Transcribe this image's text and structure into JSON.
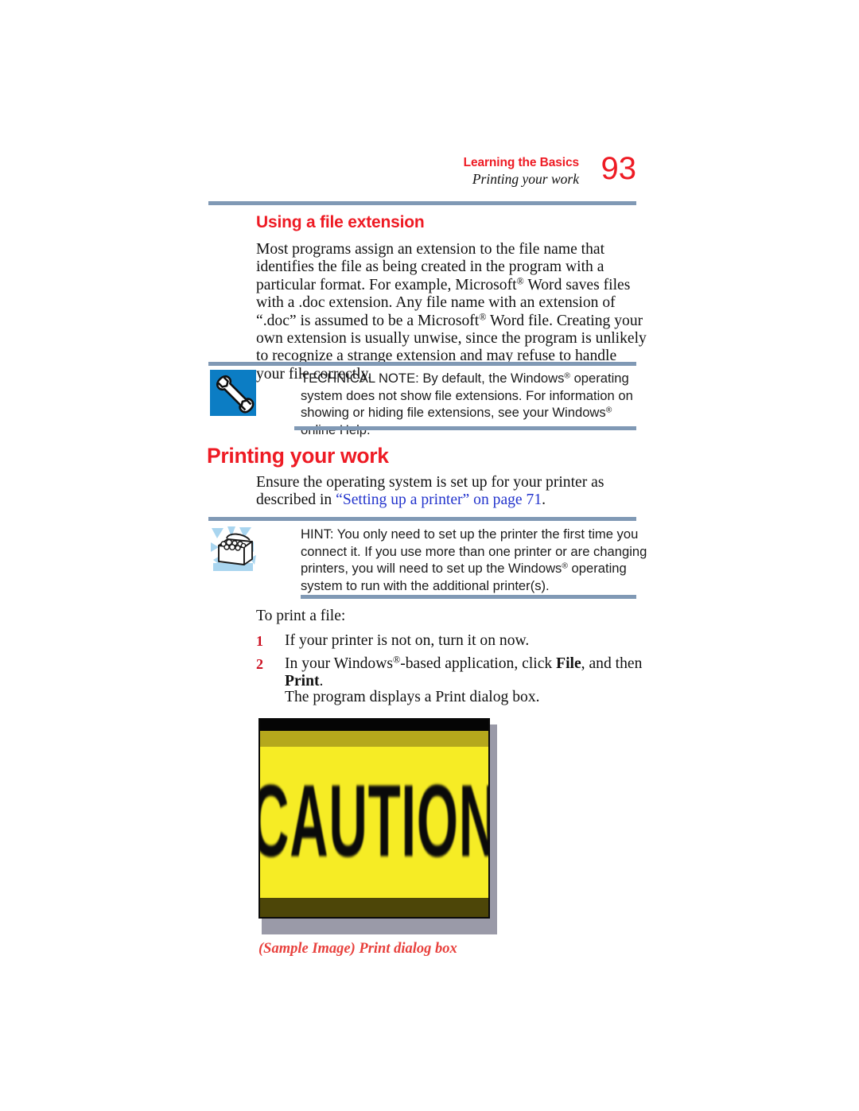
{
  "header": {
    "chapter": "Learning the Basics",
    "section": "Printing your work",
    "page_number": "93"
  },
  "headings": {
    "subsection": "Using a file extension",
    "section": "Printing your work"
  },
  "paragraphs": {
    "extension_intro_a": "Most programs assign an extension to the file name that identifies the file as being created in the program with a particular format. For example, Microsoft",
    "extension_intro_b": " Word saves files with a .doc extension. Any file name with an extension of “.doc” is assumed to be a Microsoft",
    "extension_intro_c": " Word file. Creating your own extension is usually unwise, since the program is unlikely to recognize a strange extension and may refuse to handle your file correctly.",
    "ensure_a": "Ensure the operating system is set up for your printer as described in ",
    "ensure_link": "“Setting up a printer” on page 71",
    "ensure_b": ".",
    "to_print": "To print a file:",
    "displays_dialog": "The program displays a Print dialog box."
  },
  "callouts": [
    {
      "id": "technical-note",
      "icon": "wrench-icon",
      "text_a": "TECHNICAL NOTE: By default, the Windows",
      "text_b": " operating system does not show file extensions. For information on showing or hiding file extensions, see your Windows",
      "text_c": " online Help."
    },
    {
      "id": "hint",
      "icon": "treasure-chest-icon",
      "text_a": "HINT: You only need to set up the printer the first time you connect it. If you use more than one printer or are changing printers, you will need to set up the Windows",
      "text_b": " operating system to run with the additional printer(s).",
      "text_c": ""
    }
  ],
  "steps": [
    {
      "number": "1",
      "text_a": "If your printer is not on, turn it on now.",
      "text_b": "",
      "text_c": "",
      "bold_a": "",
      "bold_b": ""
    },
    {
      "number": "2",
      "text_a": "In your Windows",
      "text_b": "-based application, click ",
      "bold_a": "File",
      "text_c": ", and then ",
      "bold_b": "Print",
      "text_d": "."
    }
  ],
  "figure": {
    "image_label": "CAUTION",
    "caption": "(Sample Image) Print dialog box"
  },
  "colors": {
    "accent_red": "#ee1b24",
    "rule_blue": "#8099b5",
    "link_blue": "#2233cc",
    "caution_yellow": "#f6ec25",
    "icon_blue": "#0c7dc4",
    "hint_blue": "#a9d5ef"
  },
  "symbols": {
    "registered": "®"
  }
}
